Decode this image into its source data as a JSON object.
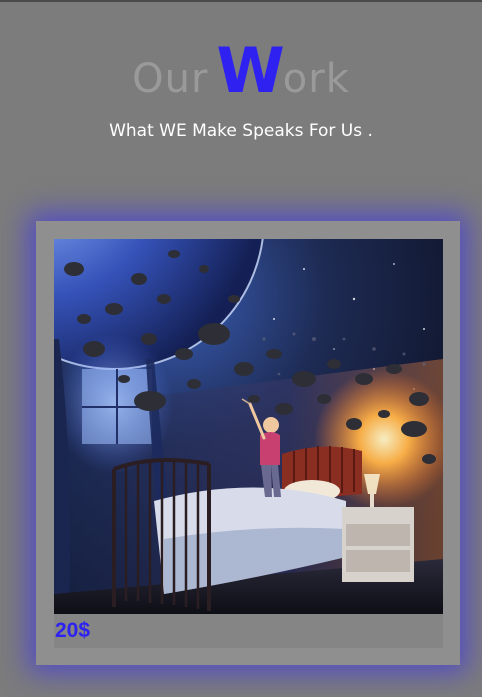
{
  "header": {
    "title_prefix": "Our",
    "title_accent": "W",
    "title_suffix": "ork",
    "subtitle": "What WE Make Speaks For Us ."
  },
  "card": {
    "image_icon": "space-bedroom-artwork",
    "price": "20$"
  },
  "colors": {
    "accent": "#2f22f0",
    "background": "#7c7c7c",
    "card": "#8f8f8f"
  }
}
